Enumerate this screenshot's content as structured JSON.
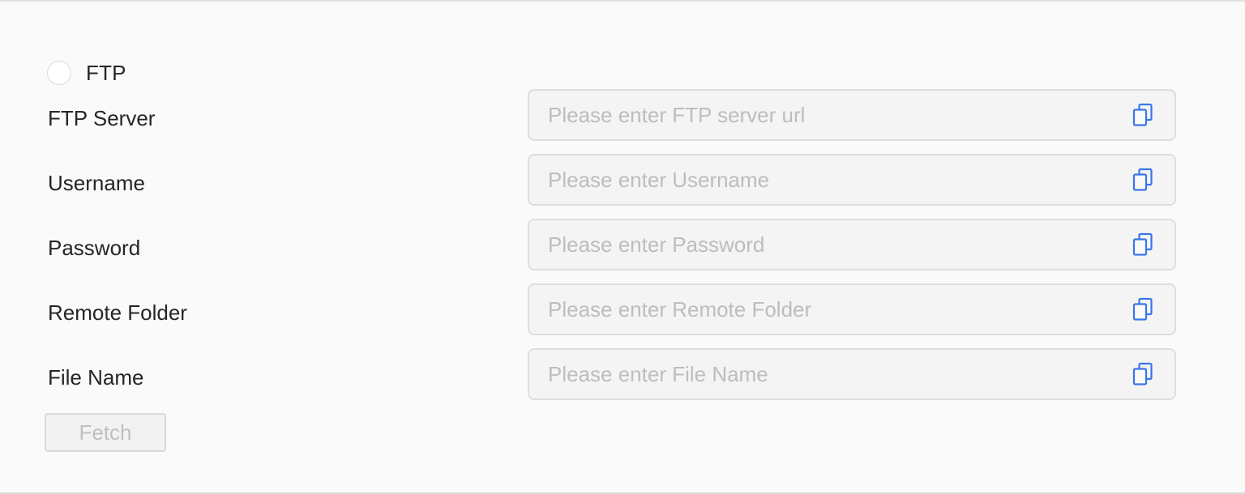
{
  "protocol": {
    "label": "FTP",
    "selected": false
  },
  "fields": [
    {
      "label": "FTP Server",
      "placeholder": "Please enter FTP server url",
      "value": ""
    },
    {
      "label": "Username",
      "placeholder": "Please enter Username",
      "value": ""
    },
    {
      "label": "Password",
      "placeholder": "Please enter Password",
      "value": ""
    },
    {
      "label": "Remote Folder",
      "placeholder": "Please enter Remote Folder",
      "value": ""
    },
    {
      "label": "File Name",
      "placeholder": "Please enter File Name",
      "value": ""
    }
  ],
  "actions": {
    "fetch_label": "Fetch",
    "fetch_disabled": true
  },
  "colors": {
    "icon_accent": "#3b76e8",
    "placeholder": "#bdbdbd",
    "input_border": "#dedede"
  },
  "icons": {
    "copy": "copy-icon"
  }
}
